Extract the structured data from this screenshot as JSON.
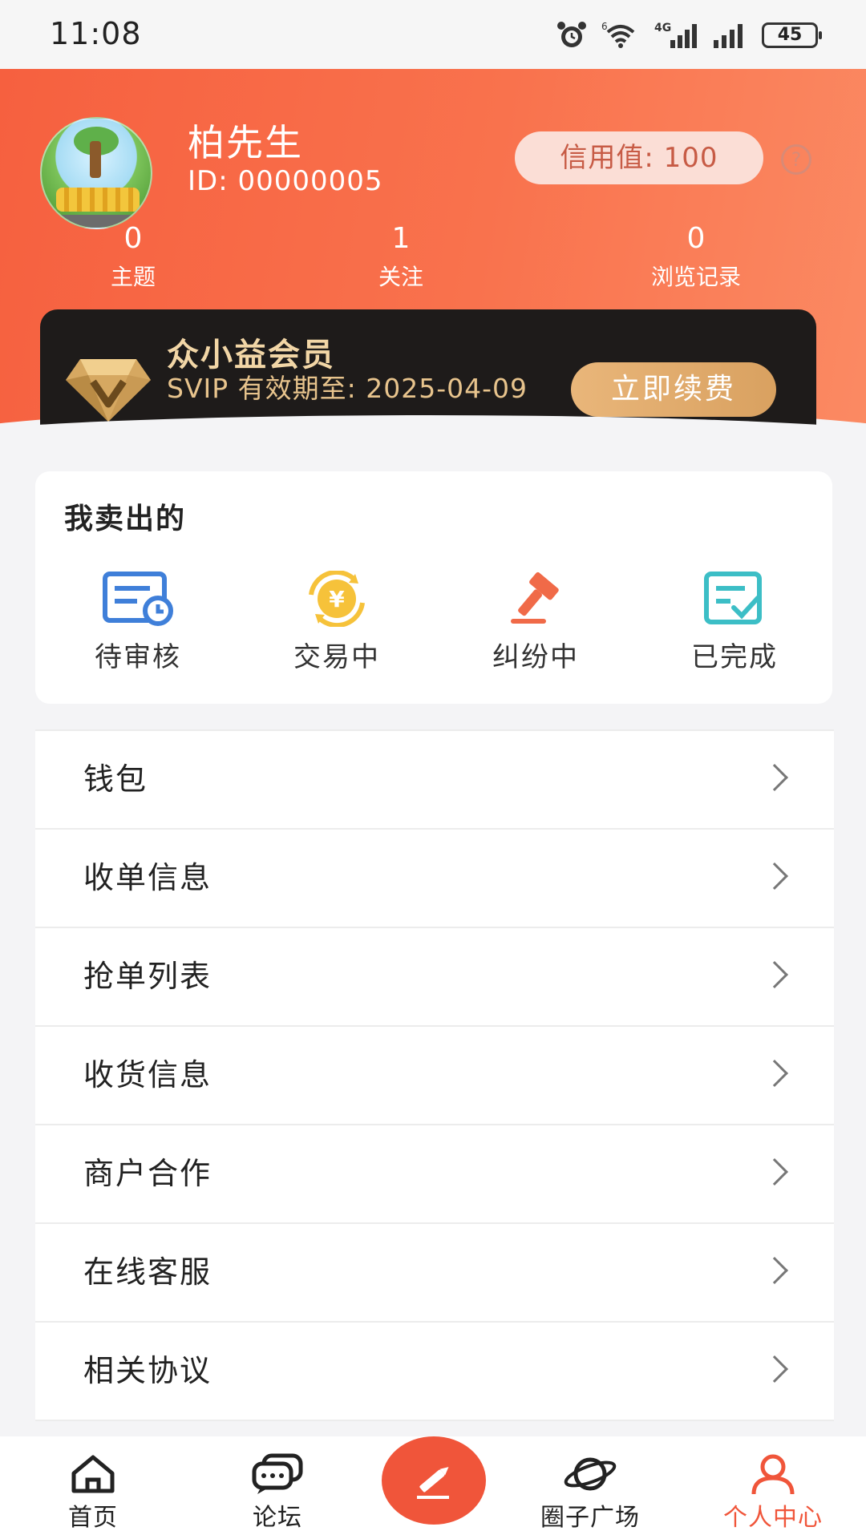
{
  "status_bar": {
    "time": "11:08",
    "network_superscript": "6",
    "network_type": "4G",
    "battery": "45",
    "icons": [
      "alarm-icon",
      "wifi-icon",
      "cellular-4g-icon",
      "cellular-icon",
      "battery-icon"
    ]
  },
  "profile": {
    "name": "柏先生",
    "id": "ID: 00000005",
    "credit": "信用值: 100",
    "help": "?",
    "stats": [
      {
        "value": "0",
        "label": "主题"
      },
      {
        "value": "1",
        "label": "关注"
      },
      {
        "value": "0",
        "label": "浏览记录"
      }
    ]
  },
  "vip": {
    "title": "众小益会员",
    "expire": "SVIP 有效期至: 2025-04-09",
    "renew": "立即续费"
  },
  "sold": {
    "title": "我卖出的",
    "items": [
      {
        "label": "待审核",
        "icon": "pending-review-icon"
      },
      {
        "label": "交易中",
        "icon": "yuan-exchange-icon"
      },
      {
        "label": "纠纷中",
        "icon": "gavel-icon"
      },
      {
        "label": "已完成",
        "icon": "completed-check-icon"
      }
    ]
  },
  "menu": {
    "items": [
      "钱包",
      "收单信息",
      "抢单列表",
      "收货信息",
      "商户合作",
      "在线客服",
      "相关协议"
    ]
  },
  "tabbar": {
    "items": [
      {
        "label": "首页",
        "icon": "home-icon"
      },
      {
        "label": "论坛",
        "icon": "chat-bubbles-icon"
      },
      {
        "label": "圈子广场",
        "icon": "planet-icon"
      },
      {
        "label": "个人中心",
        "icon": "person-icon"
      }
    ],
    "compose_icon": "pencil-icon"
  },
  "colors": {
    "accent": "#f0553a",
    "header_gradient_start": "#f6603f",
    "header_gradient_end": "#fb8a63",
    "vip_gold": "#e8c48d",
    "vip_card": "#1e1b1a"
  }
}
